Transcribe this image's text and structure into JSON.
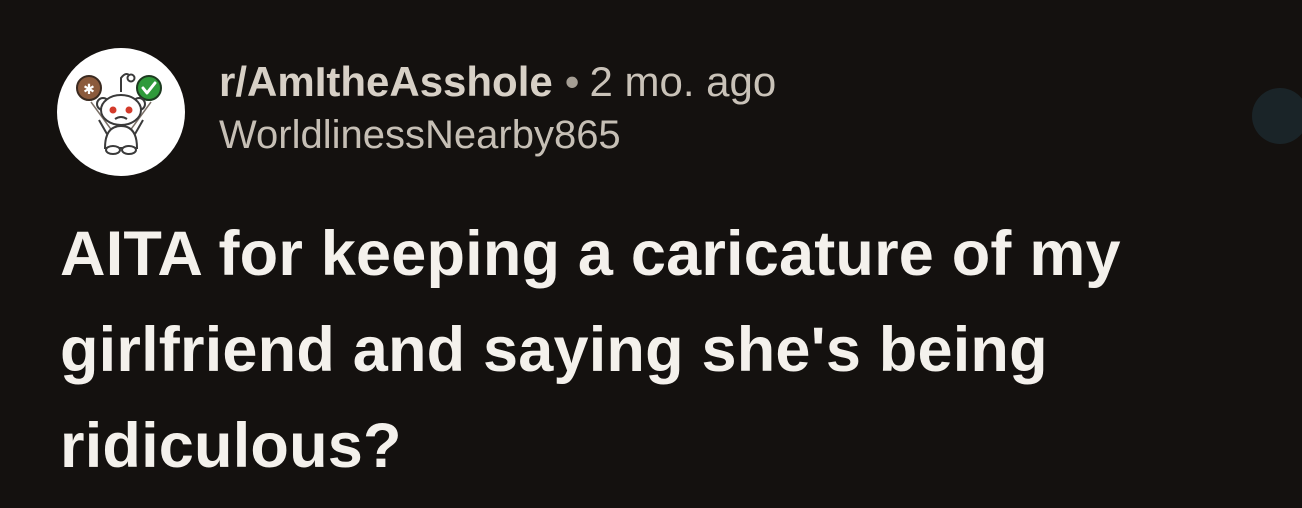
{
  "post": {
    "subreddit": "r/AmItheAsshole",
    "separator": "•",
    "age": "2 mo. ago",
    "username": "WorldlinessNearby865",
    "title": "AITA for keeping a caricature of my girlfriend and saying she's being ridiculous?"
  },
  "avatar": {
    "icon": "snoo-avatar-icon",
    "badge_left_color": "#8b5a3c",
    "badge_right_color": "#2f9a3a"
  },
  "colors": {
    "background": "#14110f",
    "title_text": "#f4f1ec",
    "meta_text": "#d6cfc5"
  }
}
